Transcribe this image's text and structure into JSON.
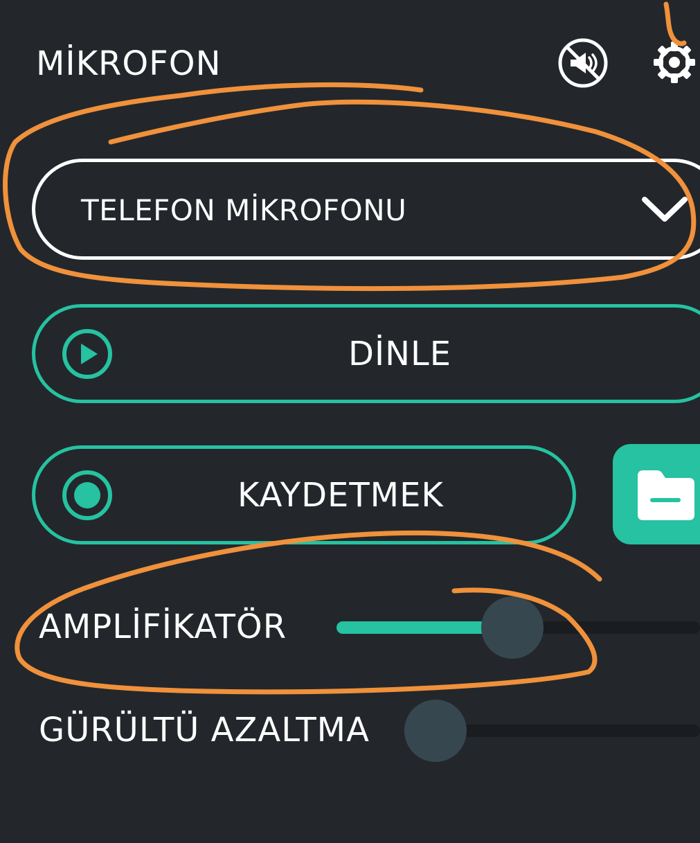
{
  "header": {
    "title": "MİKROFON",
    "mute_icon": "speaker-muted-icon",
    "settings_icon": "gear-icon"
  },
  "microphone_select": {
    "selected": "TELEFON MİKROFONU",
    "chevron_icon": "chevron-down-icon"
  },
  "listen_button": {
    "label": "DİNLE",
    "icon": "play-circle-icon"
  },
  "record_button": {
    "label": "KAYDETMEK",
    "icon": "record-circle-icon"
  },
  "folder_button": {
    "icon": "folder-icon"
  },
  "amplifier": {
    "label": "AMPLİFİKATÖR",
    "value_fraction": 0.48
  },
  "noise_reduction": {
    "label": "GÜRÜLTÜ AZALTMA",
    "value_fraction": 0.0
  },
  "colors": {
    "background": "#23272b",
    "accent": "#26c2a1",
    "thumb": "#37474f",
    "annotation": "#f0913c"
  }
}
